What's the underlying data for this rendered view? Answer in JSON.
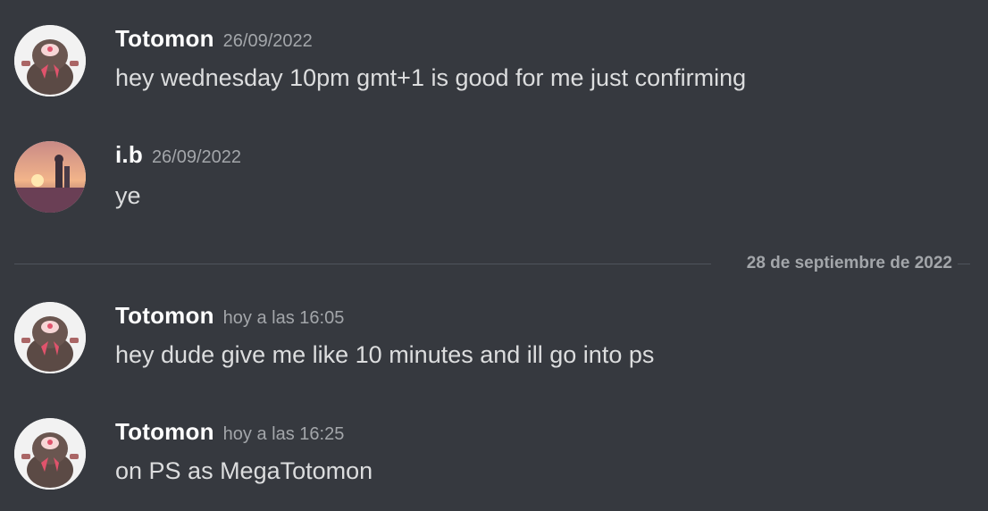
{
  "messages": [
    {
      "username": "Totomon",
      "timestamp": "26/09/2022",
      "content": "hey wednesday 10pm gmt+1 is good for me just confirming",
      "avatar_icon": "totomon-avatar"
    },
    {
      "username": "i.b",
      "timestamp": "26/09/2022",
      "content": "ye",
      "avatar_icon": "sunset-avatar"
    },
    {
      "username": "Totomon",
      "timestamp": "hoy a las 16:05",
      "content": "hey dude give me like 10 minutes and ill go into ps",
      "avatar_icon": "totomon-avatar"
    },
    {
      "username": "Totomon",
      "timestamp": "hoy a las 16:25",
      "content": "on PS as MegaTotomon",
      "avatar_icon": "totomon-avatar"
    }
  ],
  "date_divider": {
    "label": "28 de septiembre de 2022"
  },
  "colors": {
    "background": "#36393f",
    "username": "#ffffff",
    "text": "#dcddde",
    "muted": "#a3a6aa",
    "divider": "#4f545c"
  }
}
